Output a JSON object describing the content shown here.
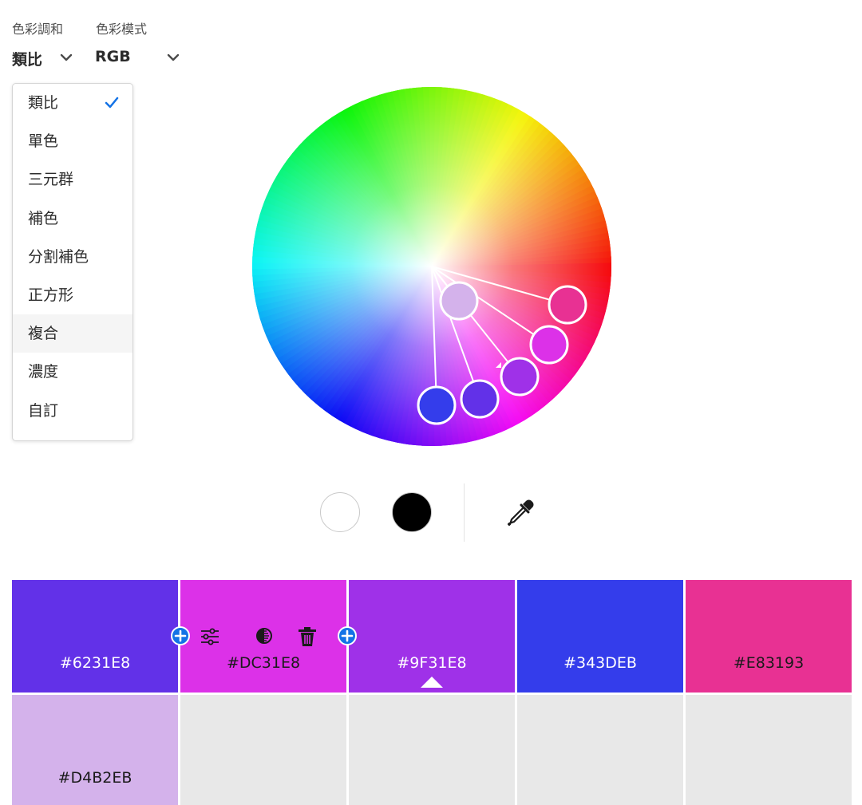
{
  "controls": {
    "harmony_label": "色彩調和",
    "harmony_value": "類比",
    "mode_label": "色彩模式",
    "mode_value": "RGB"
  },
  "harmony_menu": {
    "items": [
      "類比",
      "單色",
      "三元群",
      "補色",
      "分割補色",
      "正方形",
      "複合",
      "濃度",
      "自訂"
    ],
    "selected": "類比",
    "highlighted": "複合"
  },
  "wheel_markers": [
    "#D4B2EB",
    "#E83193",
    "#DC31E8",
    "#9F31E8",
    "#6231E8",
    "#343DEB"
  ],
  "tools": {
    "white_swatch": "#FFFFFF",
    "black_swatch": "#000000",
    "icons": [
      "eyedropper-icon",
      "add-icon",
      "sliders-icon",
      "contrast-icon",
      "trash-icon"
    ]
  },
  "palette": {
    "row1": [
      {
        "hex": "#6231E8",
        "color": "#6231E8",
        "text_color": "#ffffff"
      },
      {
        "hex": "#DC31E8",
        "color": "#DC31E8",
        "text_color": "#1a1a1a"
      },
      {
        "hex": "#9F31E8",
        "color": "#9F31E8",
        "text_color": "#ffffff"
      },
      {
        "hex": "#343DEB",
        "color": "#343DEB",
        "text_color": "#ffffff"
      },
      {
        "hex": "#E83193",
        "color": "#E83193",
        "text_color": "#1a1a1a"
      }
    ],
    "row2": [
      {
        "hex": "#D4B2EB",
        "color": "#D4B2EB",
        "text_color": "#1a1a1a"
      },
      {
        "hex": "",
        "color": "#E8E8E8"
      },
      {
        "hex": "",
        "color": "#E8E8E8"
      },
      {
        "hex": "",
        "color": "#E8E8E8"
      },
      {
        "hex": "",
        "color": "#E8E8E8"
      }
    ],
    "active_index": 2
  }
}
